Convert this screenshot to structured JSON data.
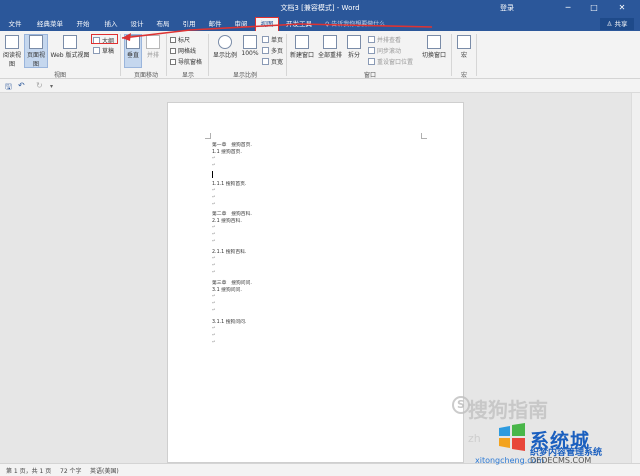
{
  "titlebar": {
    "title": "文档3 [兼容模式] - Word",
    "login": "登录",
    "min": "─",
    "restore": "□",
    "close": "✕"
  },
  "tabs": [
    {
      "label": "文件"
    },
    {
      "label": "经典菜单"
    },
    {
      "label": "开始"
    },
    {
      "label": "插入"
    },
    {
      "label": "设计"
    },
    {
      "label": "布局"
    },
    {
      "label": "引用"
    },
    {
      "label": "邮件"
    },
    {
      "label": "审阅"
    },
    {
      "label": "视图"
    },
    {
      "label": "开发工具"
    }
  ],
  "tell_me": "♀ 告诉我你想要做什么",
  "share": "♙ 共享",
  "ribbon": {
    "views": {
      "read_mode": "阅读视图",
      "print_layout": "页面视图",
      "web_layout": "Web 版式视图",
      "outline": "大纲",
      "draft": "草稿",
      "group_label": "视图"
    },
    "page_move": {
      "vertical": "垂直",
      "side": "并排",
      "group_label": "页面移动"
    },
    "show": {
      "ruler": "标尺",
      "gridlines": "网格线",
      "nav_pane": "导航窗格",
      "group_label": "显示"
    },
    "zoom": {
      "zoom": "显示比例",
      "hundred": "100%",
      "one_page": "单页",
      "multi_page": "多页",
      "page_width": "页宽",
      "group_label": "显示比例"
    },
    "window": {
      "new_window": "新建窗口",
      "arrange_all": "全部重排",
      "split": "拆分",
      "side_by_side": "并排查看",
      "sync_scroll": "同步滚动",
      "reset_position": "重设窗口位置",
      "switch_windows": "切换窗口",
      "group_label": "窗口"
    },
    "macros": {
      "macros": "宏",
      "group_label": "宏"
    }
  },
  "qat": {
    "save": "🖫",
    "undo": "↶",
    "redo": "↻",
    "more": "▾"
  },
  "document": {
    "lines": [
      {
        "text": "第一章　搜狗首页."
      },
      {
        "text": "1.1 搜狗首页."
      },
      {
        "text": "1.1.1 搜狗首页."
      },
      {
        "text": "第二章　搜狗百科."
      },
      {
        "text": "2.1 搜狗百科."
      },
      {
        "text": "2.1.1 搜狗百科."
      },
      {
        "text": "第三章　搜狗问问."
      },
      {
        "text": "3.1 搜狗问问."
      },
      {
        "text": "3.1.1 搜狗问问."
      }
    ],
    "para_mark": "↵"
  },
  "statusbar": {
    "pages": "第 1 页，共 1 页",
    "words": "72 个字",
    "lang": "英语(美国)"
  },
  "watermarks": {
    "sogou": "搜狗指南",
    "sogou_letter": "S",
    "zh": "zh",
    "site_a": "xitongcheng.com",
    "brand_cn": "系统城",
    "brand_sub": "织梦内容管理系统",
    "brand_url": "DEDECMS.COM"
  },
  "colors": {
    "accent": "#2b579a",
    "highlight": "#e03030",
    "watermark_blue": "#1a5fbf"
  }
}
